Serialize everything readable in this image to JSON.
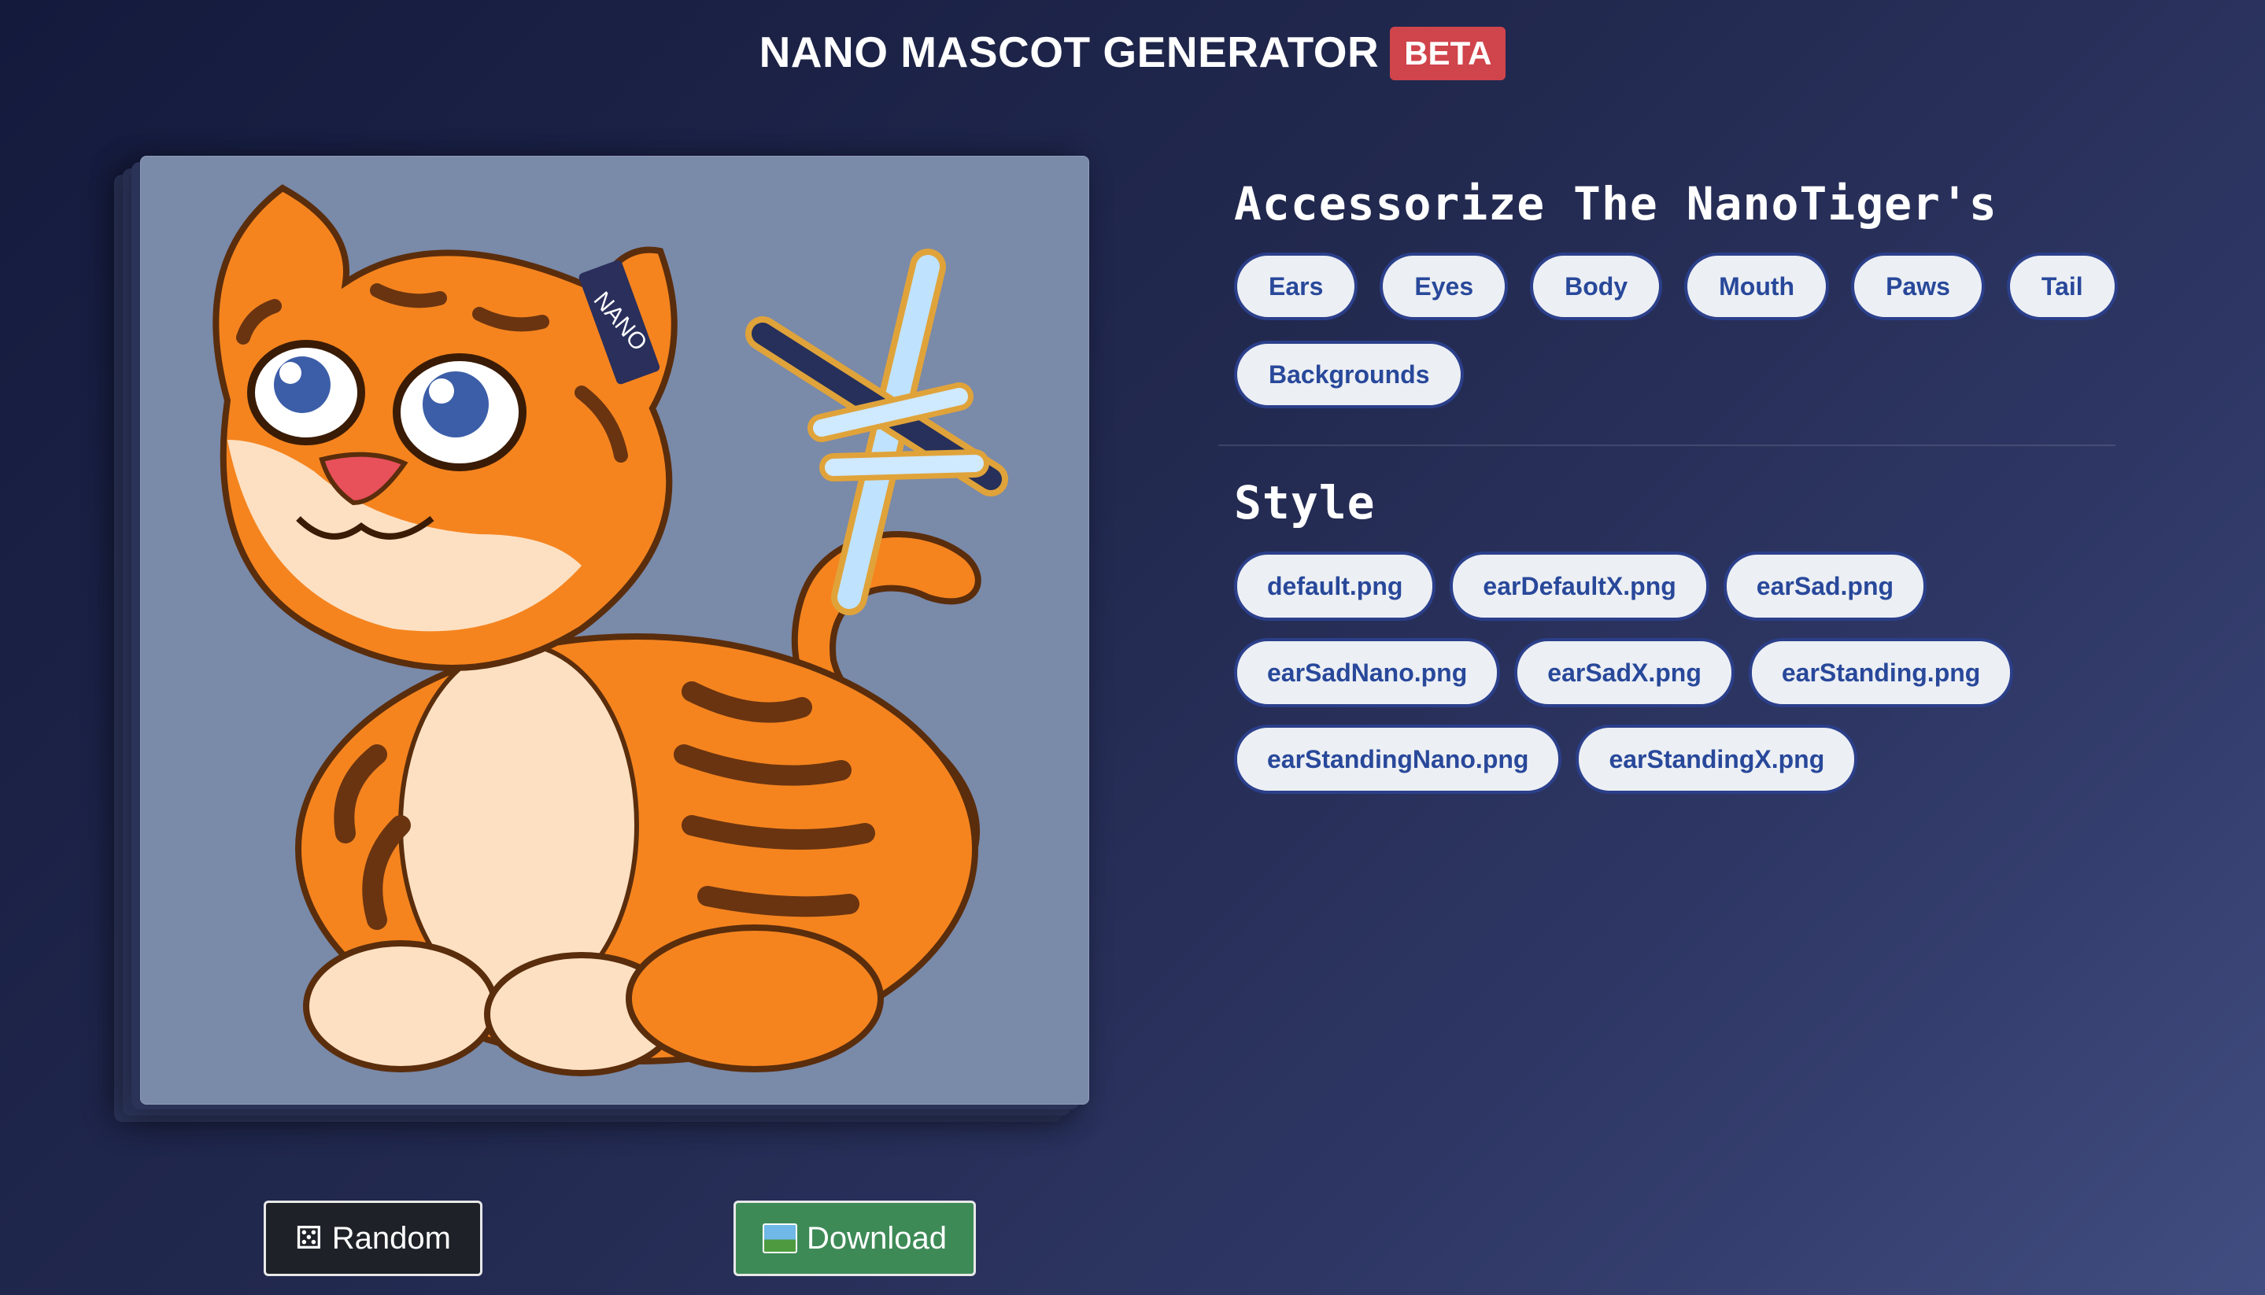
{
  "header": {
    "title": "NANO MASCOT GENERATOR",
    "badge": "BETA"
  },
  "preview": {
    "tag_text": "NANO",
    "background_color": "#7a8aa9"
  },
  "actions": {
    "random_label": "Random",
    "random_icon": "dice-icon",
    "download_label": "Download",
    "download_icon": "picture-icon"
  },
  "accessorize": {
    "title": "Accessorize The NanoTiger's",
    "categories": [
      "Ears",
      "Eyes",
      "Body",
      "Mouth",
      "Paws",
      "Tail",
      "Backgrounds"
    ]
  },
  "style": {
    "title": "Style",
    "options": [
      "default.png",
      "earDefaultX.png",
      "earSad.png",
      "earSadNano.png",
      "earSadX.png",
      "earStanding.png",
      "earStandingNano.png",
      "earStandingX.png"
    ]
  },
  "colors": {
    "accent_chip_text": "#28489a",
    "beta": "#d0444c",
    "download": "#3e8a57",
    "tiger_orange": "#f5841f"
  }
}
